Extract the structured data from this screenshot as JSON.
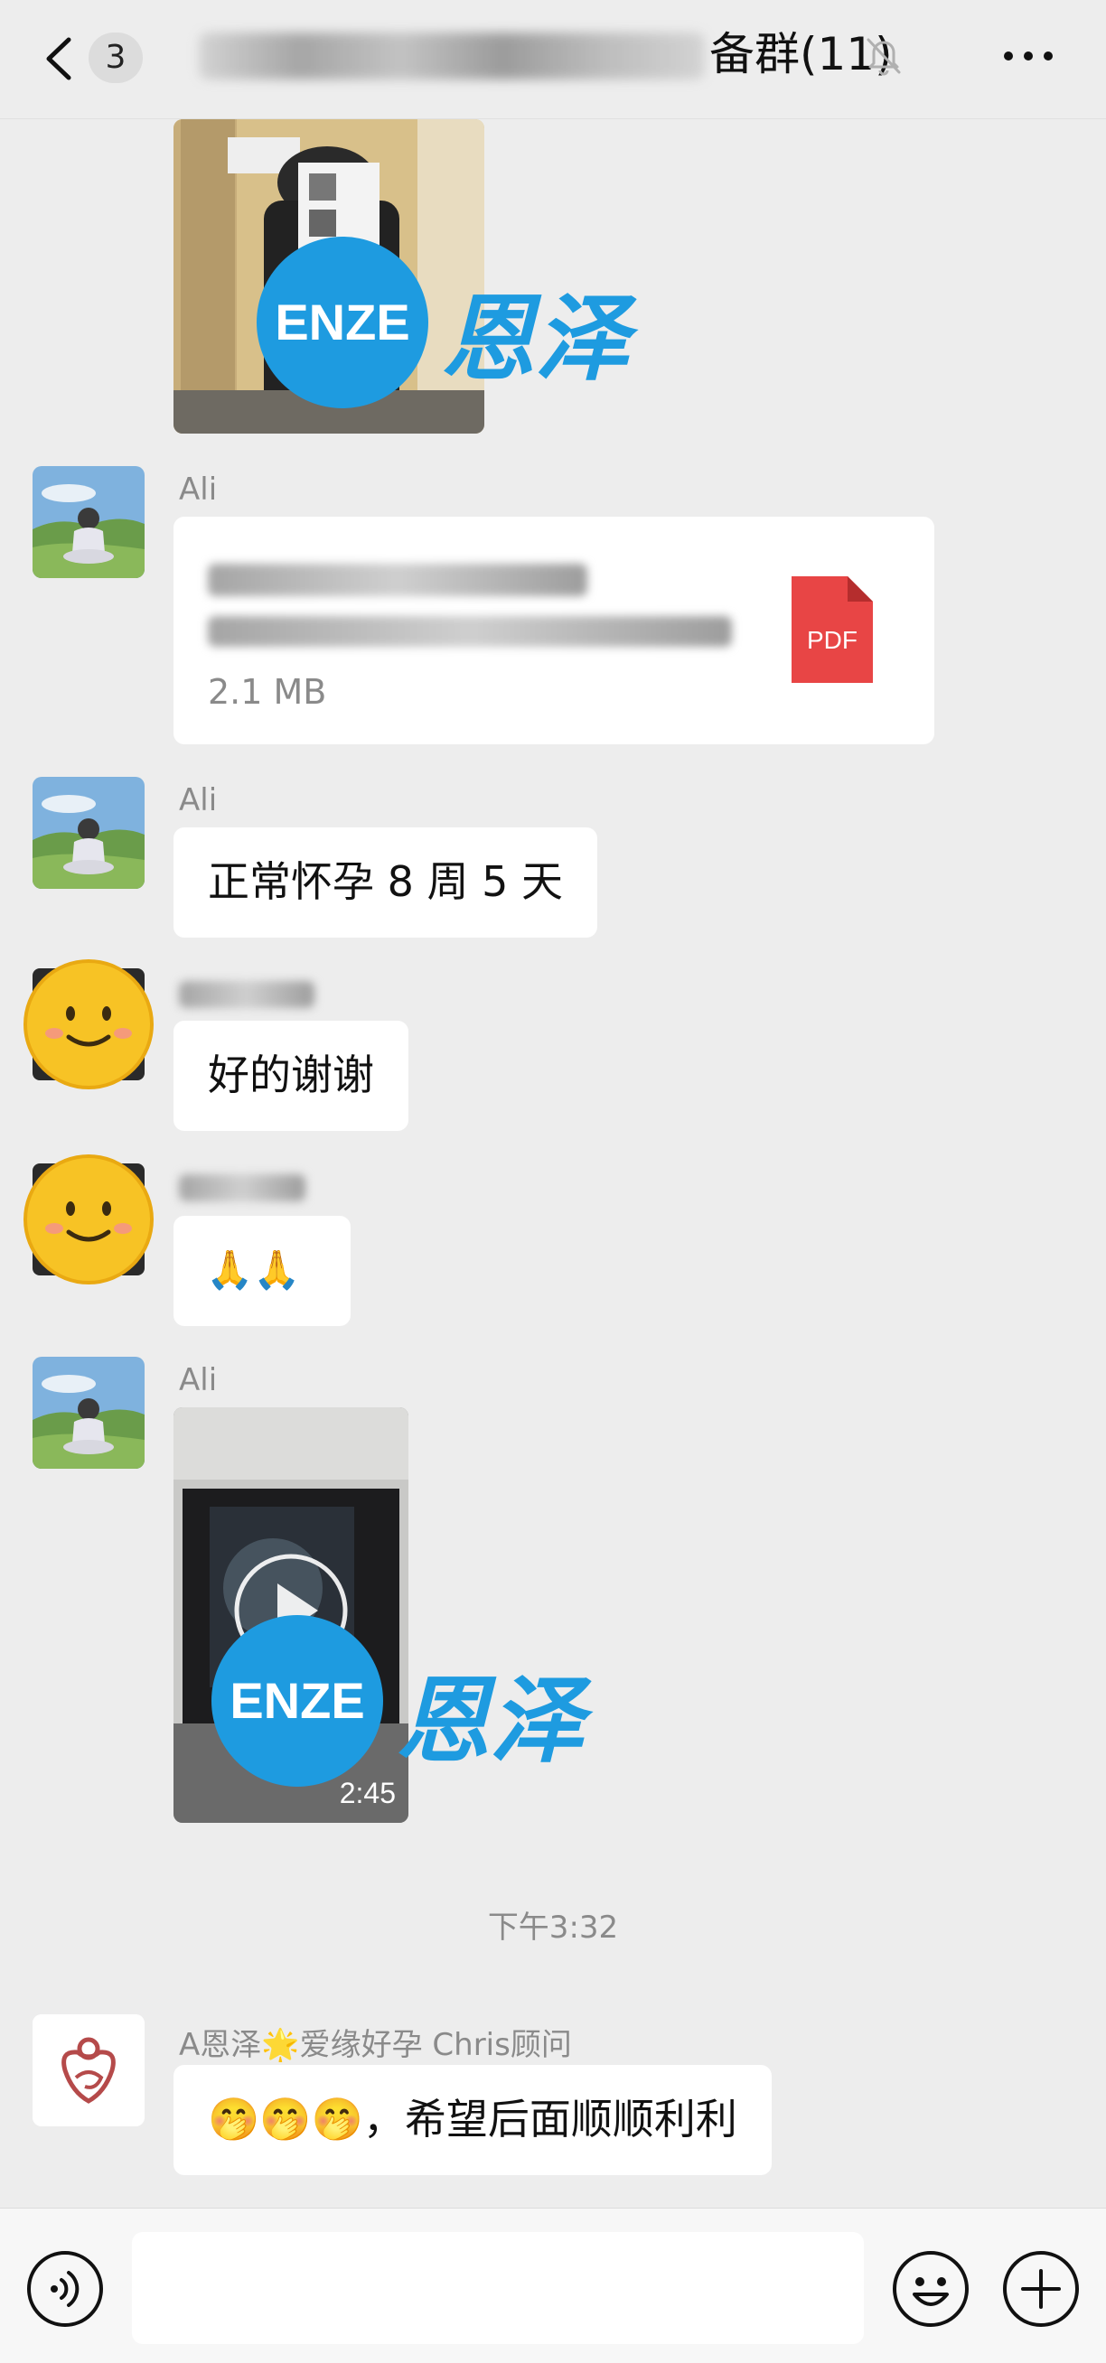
{
  "header": {
    "unread_count": "3",
    "title_suffix": "备群(11)"
  },
  "messages": [
    {
      "type": "image",
      "watermark_en": "ENZE",
      "watermark_cn": "恩泽"
    },
    {
      "type": "file",
      "sender": "Ali",
      "file_size": "2.1 MB",
      "file_type": "PDF"
    },
    {
      "type": "text",
      "sender": "Ali",
      "text": "正常怀孕 8 周 5 天"
    },
    {
      "type": "text",
      "sender": "",
      "text": "好的谢谢"
    },
    {
      "type": "emoji",
      "sender": "",
      "text": "🙏🙏"
    },
    {
      "type": "video",
      "sender": "Ali",
      "duration": "2:45",
      "watermark_en": "ENZE",
      "watermark_cn": "恩泽"
    },
    {
      "type": "text",
      "sender": "A恩泽🌟爱缘好孕 Chris顾问",
      "text": "🤭🤭🤭，希望后面顺顺利利"
    }
  ],
  "timestamp": "下午3:32",
  "icons": {
    "back": "chevron-left-icon",
    "mute": "bell-off-icon",
    "more": "more-dots-icon",
    "voice": "voice-icon",
    "emoji": "emoji-icon",
    "plus": "plus-icon"
  },
  "colors": {
    "background": "#ededed",
    "bubble": "#ffffff",
    "watermark": "#1e9be0",
    "pdf": "#e84545"
  }
}
